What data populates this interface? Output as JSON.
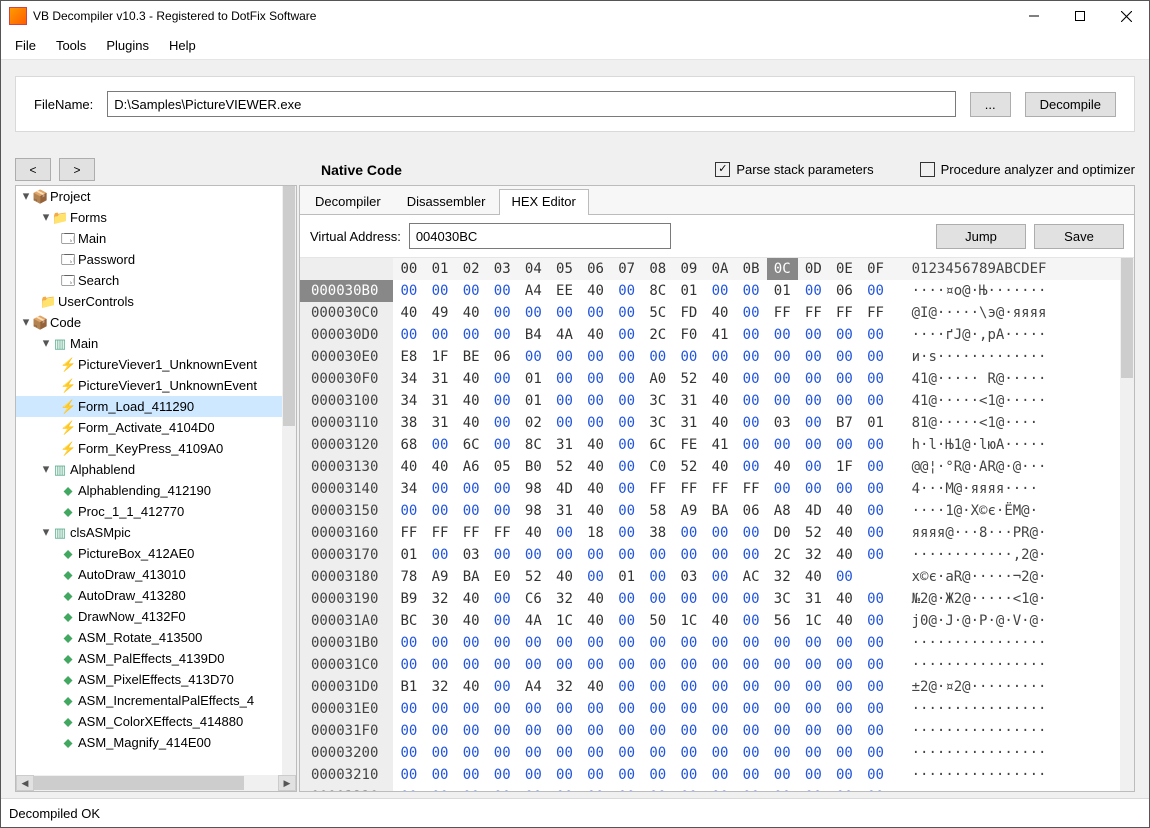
{
  "window": {
    "title": "VB Decompiler v10.3 - Registered to DotFix Software"
  },
  "menu": [
    "File",
    "Tools",
    "Plugins",
    "Help"
  ],
  "filename": {
    "label": "FileName:",
    "value": "D:\\Samples\\PictureVIEWER.exe",
    "browse": "...",
    "decompile": "Decompile"
  },
  "row2": {
    "back": "<",
    "fwd": ">",
    "native": "Native Code",
    "parse": "Parse stack parameters",
    "optimizer": "Procedure analyzer and optimizer",
    "parse_checked": true,
    "optimizer_checked": false
  },
  "tree": [
    {
      "d": 0,
      "t": "tw",
      "k": "open"
    },
    {
      "d": 0,
      "t": "ic",
      "k": "proj"
    },
    {
      "d": 0,
      "t": "lbl",
      "v": "Project",
      "br": 1
    },
    {
      "d": 1,
      "t": "tw",
      "k": "open"
    },
    {
      "d": 1,
      "t": "ic",
      "k": "folder"
    },
    {
      "d": 1,
      "t": "lbl",
      "v": "Forms",
      "br": 1
    },
    {
      "d": 2,
      "t": "ic",
      "k": "form"
    },
    {
      "d": 2,
      "t": "lbl",
      "v": "Main",
      "br": 1
    },
    {
      "d": 2,
      "t": "ic",
      "k": "form"
    },
    {
      "d": 2,
      "t": "lbl",
      "v": "Password",
      "br": 1
    },
    {
      "d": 2,
      "t": "ic",
      "k": "form"
    },
    {
      "d": 2,
      "t": "lbl",
      "v": "Search",
      "br": 1
    },
    {
      "d": 1,
      "t": "ic",
      "k": "folder"
    },
    {
      "d": 1,
      "t": "lbl",
      "v": "UserControls",
      "br": 1
    },
    {
      "d": 0,
      "t": "tw",
      "k": "open"
    },
    {
      "d": 0,
      "t": "ic",
      "k": "proj"
    },
    {
      "d": 0,
      "t": "lbl",
      "v": "Code",
      "br": 1
    },
    {
      "d": 1,
      "t": "tw",
      "k": "open"
    },
    {
      "d": 1,
      "t": "ic",
      "k": "mod"
    },
    {
      "d": 1,
      "t": "lbl",
      "v": "Main",
      "br": 1
    },
    {
      "d": 2,
      "t": "ic",
      "k": "fn"
    },
    {
      "d": 2,
      "t": "lbl",
      "v": "PictureViever1_UnknownEvent",
      "br": 1
    },
    {
      "d": 2,
      "t": "ic",
      "k": "fn"
    },
    {
      "d": 2,
      "t": "lbl",
      "v": "PictureViever1_UnknownEvent",
      "br": 1
    },
    {
      "d": 2,
      "t": "ic",
      "k": "fn"
    },
    {
      "d": 2,
      "t": "lbl",
      "v": "Form_Load_411290",
      "sel": true,
      "br": 1
    },
    {
      "d": 2,
      "t": "ic",
      "k": "fn"
    },
    {
      "d": 2,
      "t": "lbl",
      "v": "Form_Activate_4104D0",
      "br": 1
    },
    {
      "d": 2,
      "t": "ic",
      "k": "fn"
    },
    {
      "d": 2,
      "t": "lbl",
      "v": "Form_KeyPress_4109A0",
      "br": 1
    },
    {
      "d": 1,
      "t": "tw",
      "k": "open"
    },
    {
      "d": 1,
      "t": "ic",
      "k": "mod"
    },
    {
      "d": 1,
      "t": "lbl",
      "v": "Alphablend",
      "br": 1
    },
    {
      "d": 2,
      "t": "ic",
      "k": "proc"
    },
    {
      "d": 2,
      "t": "lbl",
      "v": "Alphablending_412190",
      "br": 1
    },
    {
      "d": 2,
      "t": "ic",
      "k": "proc"
    },
    {
      "d": 2,
      "t": "lbl",
      "v": "Proc_1_1_412770",
      "br": 1
    },
    {
      "d": 1,
      "t": "tw",
      "k": "open"
    },
    {
      "d": 1,
      "t": "ic",
      "k": "mod"
    },
    {
      "d": 1,
      "t": "lbl",
      "v": "clsASMpic",
      "br": 1
    },
    {
      "d": 2,
      "t": "ic",
      "k": "proc"
    },
    {
      "d": 2,
      "t": "lbl",
      "v": "PictureBox_412AE0",
      "br": 1
    },
    {
      "d": 2,
      "t": "ic",
      "k": "proc"
    },
    {
      "d": 2,
      "t": "lbl",
      "v": "AutoDraw_413010",
      "br": 1
    },
    {
      "d": 2,
      "t": "ic",
      "k": "proc"
    },
    {
      "d": 2,
      "t": "lbl",
      "v": "AutoDraw_413280",
      "br": 1
    },
    {
      "d": 2,
      "t": "ic",
      "k": "proc"
    },
    {
      "d": 2,
      "t": "lbl",
      "v": "DrawNow_4132F0",
      "br": 1
    },
    {
      "d": 2,
      "t": "ic",
      "k": "proc"
    },
    {
      "d": 2,
      "t": "lbl",
      "v": "ASM_Rotate_413500",
      "br": 1
    },
    {
      "d": 2,
      "t": "ic",
      "k": "proc"
    },
    {
      "d": 2,
      "t": "lbl",
      "v": "ASM_PalEffects_4139D0",
      "br": 1
    },
    {
      "d": 2,
      "t": "ic",
      "k": "proc"
    },
    {
      "d": 2,
      "t": "lbl",
      "v": "ASM_PixelEffects_413D70",
      "br": 1
    },
    {
      "d": 2,
      "t": "ic",
      "k": "proc"
    },
    {
      "d": 2,
      "t": "lbl",
      "v": "ASM_IncrementalPalEffects_4",
      "br": 1
    },
    {
      "d": 2,
      "t": "ic",
      "k": "proc"
    },
    {
      "d": 2,
      "t": "lbl",
      "v": "ASM_ColorXEffects_414880",
      "br": 1
    },
    {
      "d": 2,
      "t": "ic",
      "k": "proc"
    },
    {
      "d": 2,
      "t": "lbl",
      "v": "ASM_Magnify_414E00",
      "br": 1
    }
  ],
  "tabs": {
    "items": [
      "Decompiler",
      "Disassembler",
      "HEX Editor"
    ],
    "active": 2
  },
  "vaddr": {
    "label": "Virtual Address:",
    "value": "004030BC",
    "jump": "Jump",
    "save": "Save"
  },
  "hex": {
    "cols": [
      "00",
      "01",
      "02",
      "03",
      "04",
      "05",
      "06",
      "07",
      "08",
      "09",
      "0A",
      "0B",
      "0C",
      "0D",
      "0E",
      "0F"
    ],
    "sel_col": 12,
    "ascii_header": "0123456789ABCDEF",
    "rows": [
      {
        "a": "000030B0",
        "sel": true,
        "b": [
          "00",
          "00",
          "00",
          "00",
          "A4",
          "EE",
          "40",
          "00",
          "8C",
          "01",
          "00",
          "00",
          "01",
          "00",
          "06",
          "00"
        ],
        "s": "····¤о@·Њ·······"
      },
      {
        "a": "000030C0",
        "b": [
          "40",
          "49",
          "40",
          "00",
          "00",
          "00",
          "00",
          "00",
          "5C",
          "FD",
          "40",
          "00",
          "FF",
          "FF",
          "FF",
          "FF"
        ],
        "s": "@I@·····\\э@·яяяя"
      },
      {
        "a": "000030D0",
        "b": [
          "00",
          "00",
          "00",
          "00",
          "B4",
          "4A",
          "40",
          "00",
          "2C",
          "F0",
          "41",
          "00",
          "00",
          "00",
          "00",
          "00"
        ],
        "s": "····ґJ@·,рA·····"
      },
      {
        "a": "000030E0",
        "b": [
          "E8",
          "1F",
          "BE",
          "06",
          "00",
          "00",
          "00",
          "00",
          "00",
          "00",
          "00",
          "00",
          "00",
          "00",
          "00",
          "00"
        ],
        "s": "и·s·············"
      },
      {
        "a": "000030F0",
        "b": [
          "34",
          "31",
          "40",
          "00",
          "01",
          "00",
          "00",
          "00",
          "A0",
          "52",
          "40",
          "00",
          "00",
          "00",
          "00",
          "00"
        ],
        "s": "41@····· R@·····"
      },
      {
        "a": "00003100",
        "b": [
          "34",
          "31",
          "40",
          "00",
          "01",
          "00",
          "00",
          "00",
          "3C",
          "31",
          "40",
          "00",
          "00",
          "00",
          "00",
          "00"
        ],
        "s": "41@·····<1@·····"
      },
      {
        "a": "00003110",
        "b": [
          "38",
          "31",
          "40",
          "00",
          "02",
          "00",
          "00",
          "00",
          "3C",
          "31",
          "40",
          "00",
          "03",
          "00",
          "B7",
          "01"
        ],
        "s": "81@·····<1@····"
      },
      {
        "a": "00003120",
        "b": [
          "68",
          "00",
          "6C",
          "00",
          "8C",
          "31",
          "40",
          "00",
          "6C",
          "FE",
          "41",
          "00",
          "00",
          "00",
          "00",
          "00"
        ],
        "s": "h·l·Њ1@·lюA·····"
      },
      {
        "a": "00003130",
        "b": [
          "40",
          "40",
          "A6",
          "05",
          "B0",
          "52",
          "40",
          "00",
          "C0",
          "52",
          "40",
          "00",
          "40",
          "00",
          "1F",
          "00"
        ],
        "s": "@@¦·°R@·АR@·@···"
      },
      {
        "a": "00003140",
        "b": [
          "34",
          "00",
          "00",
          "00",
          "98",
          "4D",
          "40",
          "00",
          "FF",
          "FF",
          "FF",
          "FF",
          "00",
          "00",
          "00",
          "00"
        ],
        "s": "4···М@·яяяя····"
      },
      {
        "a": "00003150",
        "b": [
          "00",
          "00",
          "00",
          "00",
          "98",
          "31",
          "40",
          "00",
          "58",
          "A9",
          "BA",
          "06",
          "A8",
          "4D",
          "40",
          "00"
        ],
        "s": "····1@·X©є·ЁM@·"
      },
      {
        "a": "00003160",
        "b": [
          "FF",
          "FF",
          "FF",
          "FF",
          "40",
          "00",
          "18",
          "00",
          "38",
          "00",
          "00",
          "00",
          "D0",
          "52",
          "40",
          "00"
        ],
        "s": "яяяя@···8···РR@·"
      },
      {
        "a": "00003170",
        "b": [
          "01",
          "00",
          "03",
          "00",
          "00",
          "00",
          "00",
          "00",
          "00",
          "00",
          "00",
          "00",
          "2C",
          "32",
          "40",
          "00"
        ],
        "s": "············,2@·"
      },
      {
        "a": "00003180",
        "b": [
          "78",
          "A9",
          "BA",
          "E0",
          "52",
          "40",
          "00",
          "01",
          "00",
          "03",
          "00",
          "AC",
          "32",
          "40",
          "00"
        ],
        "s": "x©є·аR@·····¬2@·"
      },
      {
        "a": "00003190",
        "b": [
          "B9",
          "32",
          "40",
          "00",
          "C6",
          "32",
          "40",
          "00",
          "00",
          "00",
          "00",
          "00",
          "3C",
          "31",
          "40",
          "00"
        ],
        "s": "№2@·Ж2@·····<1@·"
      },
      {
        "a": "000031A0",
        "b": [
          "BC",
          "30",
          "40",
          "00",
          "4A",
          "1C",
          "40",
          "00",
          "50",
          "1C",
          "40",
          "00",
          "56",
          "1C",
          "40",
          "00"
        ],
        "s": "j0@·J·@·P·@·V·@·"
      },
      {
        "a": "000031B0",
        "b": [
          "00",
          "00",
          "00",
          "00",
          "00",
          "00",
          "00",
          "00",
          "00",
          "00",
          "00",
          "00",
          "00",
          "00",
          "00",
          "00"
        ],
        "s": "················"
      },
      {
        "a": "000031C0",
        "b": [
          "00",
          "00",
          "00",
          "00",
          "00",
          "00",
          "00",
          "00",
          "00",
          "00",
          "00",
          "00",
          "00",
          "00",
          "00",
          "00"
        ],
        "s": "················"
      },
      {
        "a": "000031D0",
        "b": [
          "B1",
          "32",
          "40",
          "00",
          "A4",
          "32",
          "40",
          "00",
          "00",
          "00",
          "00",
          "00",
          "00",
          "00",
          "00",
          "00"
        ],
        "s": "±2@·¤2@·········"
      },
      {
        "a": "000031E0",
        "b": [
          "00",
          "00",
          "00",
          "00",
          "00",
          "00",
          "00",
          "00",
          "00",
          "00",
          "00",
          "00",
          "00",
          "00",
          "00",
          "00"
        ],
        "s": "················"
      },
      {
        "a": "000031F0",
        "b": [
          "00",
          "00",
          "00",
          "00",
          "00",
          "00",
          "00",
          "00",
          "00",
          "00",
          "00",
          "00",
          "00",
          "00",
          "00",
          "00"
        ],
        "s": "················"
      },
      {
        "a": "00003200",
        "b": [
          "00",
          "00",
          "00",
          "00",
          "00",
          "00",
          "00",
          "00",
          "00",
          "00",
          "00",
          "00",
          "00",
          "00",
          "00",
          "00"
        ],
        "s": "················"
      },
      {
        "a": "00003210",
        "b": [
          "00",
          "00",
          "00",
          "00",
          "00",
          "00",
          "00",
          "00",
          "00",
          "00",
          "00",
          "00",
          "00",
          "00",
          "00",
          "00"
        ],
        "s": "················"
      },
      {
        "a": "00003220",
        "b": [
          "00",
          "00",
          "00",
          "00",
          "00",
          "00",
          "00",
          "00",
          "00",
          "00",
          "00",
          "00",
          "00",
          "00",
          "00",
          "00"
        ],
        "s": "················"
      }
    ]
  },
  "status": "Decompiled OK"
}
